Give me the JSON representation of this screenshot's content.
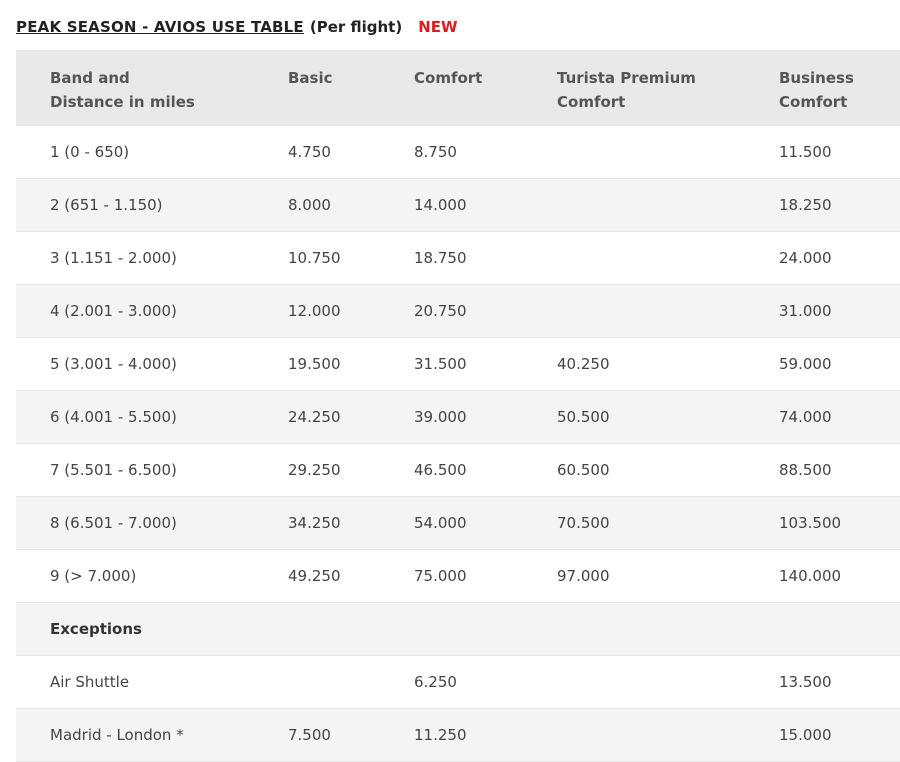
{
  "title": {
    "main": "PEAK SEASON - AVIOS USE TABLE",
    "sub": "(Per flight)",
    "new_badge": "NEW"
  },
  "colors": {
    "new_badge": "#e01b1b",
    "header_bg": "#e9e9e9",
    "alt_row_bg": "#f4f4f4"
  },
  "table": {
    "headers": [
      [
        "Band and",
        "Distance in miles"
      ],
      [
        "Basic"
      ],
      [
        "Comfort"
      ],
      [
        "Turista Premium",
        "Comfort"
      ],
      [
        "Business",
        "Comfort"
      ]
    ],
    "rows": [
      [
        "1 (0 - 650)",
        "4.750",
        "8.750",
        "",
        "11.500"
      ],
      [
        "2 (651 - 1.150)",
        "8.000",
        "14.000",
        "",
        "18.250"
      ],
      [
        "3 (1.151 - 2.000)",
        "10.750",
        "18.750",
        "",
        "24.000"
      ],
      [
        "4 (2.001 - 3.000)",
        "12.000",
        "20.750",
        "",
        "31.000"
      ],
      [
        "5 (3.001 - 4.000)",
        "19.500",
        "31.500",
        "40.250",
        "59.000"
      ],
      [
        "6 (4.001 - 5.500)",
        "24.250",
        "39.000",
        "50.500",
        "74.000"
      ],
      [
        "7 (5.501 - 6.500)",
        "29.250",
        "46.500",
        "60.500",
        "88.500"
      ],
      [
        "8 (6.501 - 7.000)",
        "34.250",
        "54.000",
        "70.500",
        "103.500"
      ],
      [
        "9 (> 7.000)",
        "49.250",
        "75.000",
        "97.000",
        "140.000"
      ]
    ],
    "exceptions_label": "Exceptions",
    "exception_rows": [
      [
        "Air Shuttle",
        "",
        "6.250",
        "",
        "13.500"
      ],
      [
        "Madrid - London *",
        "7.500",
        "11.250",
        "",
        "15.000"
      ]
    ]
  }
}
